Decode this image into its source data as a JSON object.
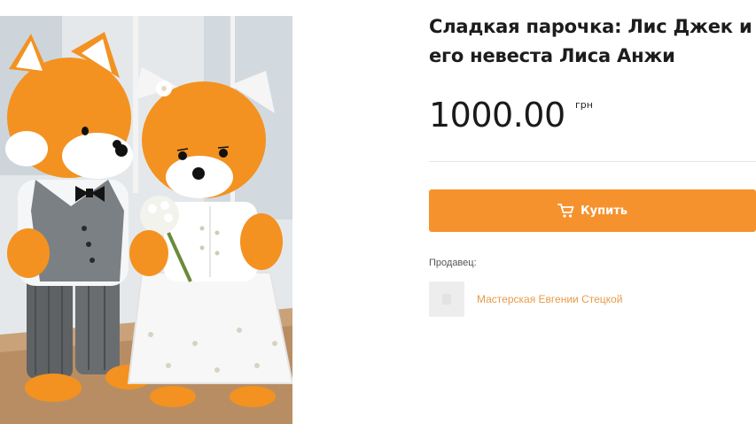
{
  "product": {
    "image_alt": "Сладкая парочка: Лис Джек и его невеста Лиса Анжи",
    "title": "Сладкая парочка: Лис Джек и его невеста Лиса Анжи",
    "price": "1000.00",
    "currency": "грн"
  },
  "actions": {
    "buy_label": "Купить",
    "buy_icon": "cart-icon"
  },
  "seller": {
    "label": "Продавец:",
    "name": "Мастерская Евгении Стецкой",
    "avatar_icon": "avatar-placeholder"
  },
  "colors": {
    "accent": "#f6922d",
    "seller_link": "#e79a4a",
    "title_text": "#1c1c1c"
  }
}
